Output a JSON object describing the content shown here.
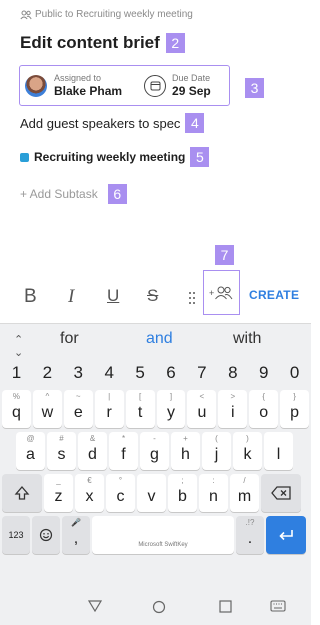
{
  "header": {
    "visibility_text": "Public to Recruiting weekly meeting",
    "title": "Edit content brief"
  },
  "badges": {
    "n2": "2",
    "n3": "3",
    "n4": "4",
    "n5": "5",
    "n6": "6",
    "n7": "7"
  },
  "assignment": {
    "assigned_label": "Assigned to",
    "assignee": "Blake Pham",
    "due_label": "Due Date",
    "due_date": "29 Sep"
  },
  "description": "Add guest speakers to spec",
  "list": {
    "name": "Recruiting weekly meeting",
    "color": "#2a9fd8"
  },
  "subtask": {
    "label": "+ Add Subtask"
  },
  "toolbar": {
    "bold": "B",
    "italic": "I",
    "underline": "U",
    "strike": "S",
    "create_label": "CREATE"
  },
  "keyboard": {
    "suggestions": [
      "for",
      "and",
      "with"
    ],
    "numbers": [
      "1",
      "2",
      "3",
      "4",
      "5",
      "6",
      "7",
      "8",
      "9",
      "0"
    ],
    "row1": [
      [
        "%",
        "q"
      ],
      [
        "^",
        "w"
      ],
      [
        "~",
        "e"
      ],
      [
        "|",
        "r"
      ],
      [
        "[",
        "t"
      ],
      [
        "]",
        "y"
      ],
      [
        "<",
        "u"
      ],
      [
        ">",
        "i"
      ],
      [
        "{",
        "o"
      ],
      [
        "}",
        "p"
      ]
    ],
    "row2": [
      [
        "@",
        "a"
      ],
      [
        "#",
        "s"
      ],
      [
        "&",
        "d"
      ],
      [
        "*",
        "f"
      ],
      [
        "-",
        "g"
      ],
      [
        "+",
        "h"
      ],
      [
        "(",
        "j"
      ],
      [
        ")",
        "k"
      ],
      [
        "",
        "l"
      ]
    ],
    "row3": [
      [
        "_",
        "z"
      ],
      [
        "€",
        "x"
      ],
      [
        "°",
        "c"
      ],
      [
        "",
        "v"
      ],
      [
        ";",
        "b"
      ],
      [
        ":",
        "n"
      ],
      [
        "/",
        "m"
      ]
    ],
    "row4": {
      "num_key": "123",
      "comma": ",",
      "space_brand": "Microsoft SwiftKey",
      "period": ".",
      "period_sec": ".!?"
    }
  },
  "accent_color": "#a98ff0"
}
